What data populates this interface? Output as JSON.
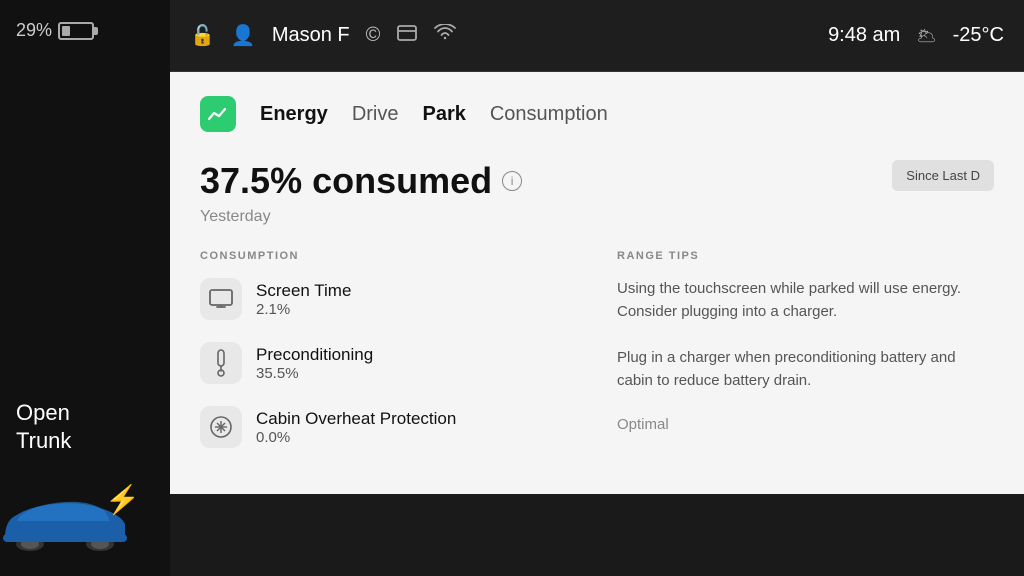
{
  "sidebar": {
    "battery_percent": "29%",
    "open_trunk_label": "Open\nTrunk"
  },
  "statusBar": {
    "user_name": "Mason F",
    "time": "9:48 am",
    "temperature": "-25°C"
  },
  "tabs": [
    {
      "id": "energy",
      "label": "Energy",
      "active": true
    },
    {
      "id": "drive",
      "label": "Drive",
      "active": false
    },
    {
      "id": "park",
      "label": "Park",
      "active": false
    },
    {
      "id": "consumption",
      "label": "Consumption",
      "active": false
    }
  ],
  "energyCard": {
    "percent_consumed": "37.5% consumed",
    "period": "Yesterday",
    "since_last_label": "Since Last D"
  },
  "consumption": {
    "section_label": "CONSUMPTION",
    "items": [
      {
        "title": "Screen Time",
        "value": "2.1%"
      },
      {
        "title": "Preconditioning",
        "value": "35.5%"
      },
      {
        "title": "Cabin Overheat Protection",
        "value": "0.0%"
      }
    ]
  },
  "rangeTips": {
    "section_label": "RANGE TIPS",
    "items": [
      {
        "text": "Using the touchscreen while parked will use energy. Consider plugging into a charger.",
        "badge": ""
      },
      {
        "text": "Plug in a charger when preconditioning battery and cabin to reduce battery drain.",
        "badge": ""
      },
      {
        "text": "",
        "badge": "Optimal"
      }
    ]
  },
  "icons": {
    "energy": "📈",
    "screen_time": "🖥",
    "preconditioning": "🌡",
    "cabin": "❄",
    "lock": "🔓",
    "person": "👤",
    "circle": "©",
    "card": "🪪",
    "wifi": "📶",
    "weather": "🌥"
  }
}
